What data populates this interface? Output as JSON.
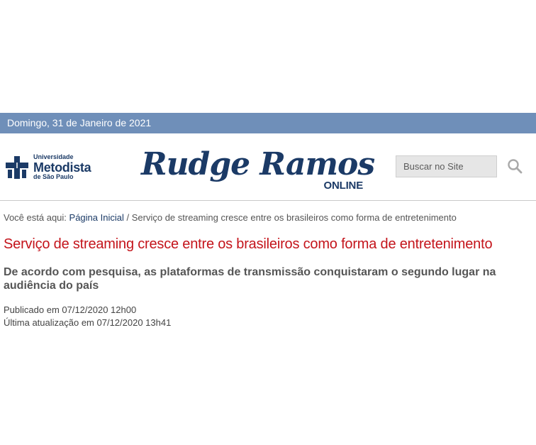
{
  "topbar": {
    "date": "Domingo, 31 de Janeiro de 2021"
  },
  "header": {
    "university_logo": {
      "line1": "Universidade",
      "line2": "Metodista",
      "line3": "de São Paulo"
    },
    "brand": {
      "title": "Rudge Ramos",
      "subtitle": "ONLINE"
    },
    "search": {
      "placeholder": "Buscar no Site",
      "icon": "search-icon"
    }
  },
  "breadcrumb": {
    "prefix": "Você está aqui:",
    "home": "Página Inicial",
    "separator": "/",
    "current": "Serviço de streaming cresce entre os brasileiros como forma de entretenimento"
  },
  "article": {
    "title": "Serviço de streaming cresce entre os brasileiros como forma de entretenimento",
    "subtitle": "De acordo com pesquisa, as plataformas de transmissão conquistaram o segundo lugar na audiência do país",
    "published": "Publicado em 07/12/2020 12h00",
    "updated": "Última atualização em 07/12/2020 13h41"
  },
  "colors": {
    "topbar_bg": "#6f8fb9",
    "brand_blue": "#1b3a66",
    "title_red": "#c4141b"
  }
}
